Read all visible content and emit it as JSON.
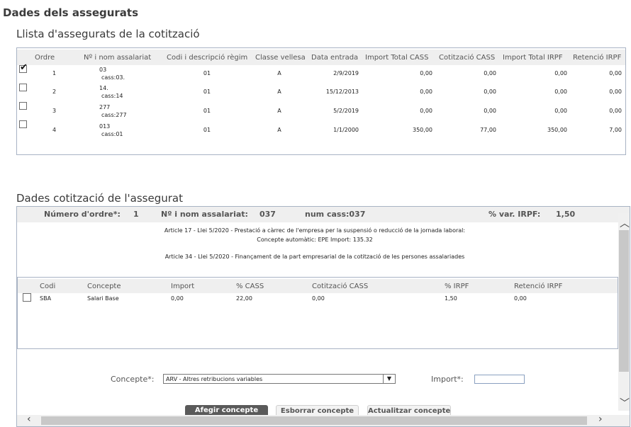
{
  "page_title": "Dades dels assegurats",
  "list_section": {
    "title": "Llista d'assegurats de la cotització",
    "columns": [
      "Ordre",
      "Nº i nom assalariat",
      "Codi i descripció règim",
      "Classe vellesa",
      "Data entrada",
      "Import Total CASS",
      "Cotització CASS",
      "Import Total IRPF",
      "Retenció IRPF"
    ],
    "rows": [
      {
        "checked": true,
        "ordre": "1",
        "num": "03",
        "cass": "cass:03.",
        "regim": "01",
        "classe": "A",
        "data": "2/9/2019",
        "import_cass": "0,00",
        "cotitzacio": "0,00",
        "import_irpf": "0,00",
        "retencio": "0,00"
      },
      {
        "checked": false,
        "ordre": "2",
        "num": "14.",
        "cass": "cass:14",
        "regim": "01",
        "classe": "A",
        "data": "15/12/2013",
        "import_cass": "0,00",
        "cotitzacio": "0,00",
        "import_irpf": "0,00",
        "retencio": "0,00"
      },
      {
        "checked": false,
        "ordre": "3",
        "num": "277",
        "cass": "cass:277",
        "regim": "01",
        "classe": "A",
        "data": "5/2/2019",
        "import_cass": "0,00",
        "cotitzacio": "0,00",
        "import_irpf": "0,00",
        "retencio": "0,00"
      },
      {
        "checked": false,
        "ordre": "4",
        "num": "013",
        "cass": "cass:01",
        "regim": "01",
        "classe": "A",
        "data": "1/1/2000",
        "import_cass": "350,00",
        "cotitzacio": "77,00",
        "import_irpf": "350,00",
        "retencio": "7,00"
      }
    ]
  },
  "detail_section": {
    "title": "Dades cotització de l'assegurat",
    "order_label": "Número d'ordre*:",
    "order_value": "1",
    "employee_label": "Nº i nom assalariat:",
    "employee_value": "037",
    "cass_label": "num cass:037",
    "irpf_label": "% var. IRPF:",
    "irpf_value": "1,50",
    "notes": [
      "Article 17 - Llei 5/2020 - Prestació a càrrec de l'empresa per la suspensió o reducció de la jornada laboral:",
      "Concepte automàtic: EPE    Import: 135.32",
      "Article 34 - Llei 5/2020 - Finançament de la part empresarial de la cotització de les persones assalariades"
    ],
    "concept_columns": [
      "Codi",
      "Concepte",
      "Import",
      "% CASS",
      "Cotització CASS",
      "% IRPF",
      "Retenció IRPF"
    ],
    "concept_rows": [
      {
        "codi": "SBA",
        "concepte": "Salari Base",
        "import": "0,00",
        "pct_cass": "22,00",
        "cotitzacio": "0,00",
        "pct_irpf": "1,50",
        "retencio": "0,00"
      }
    ],
    "form": {
      "concept_label": "Concepte*:",
      "concept_value": "ARV - Altres retribucions variables",
      "import_label": "Import*:",
      "import_value": ""
    },
    "buttons": {
      "add": "Afegir concepte",
      "delete": "Esborrar concepte",
      "update": "Actualitzar concepte"
    }
  }
}
